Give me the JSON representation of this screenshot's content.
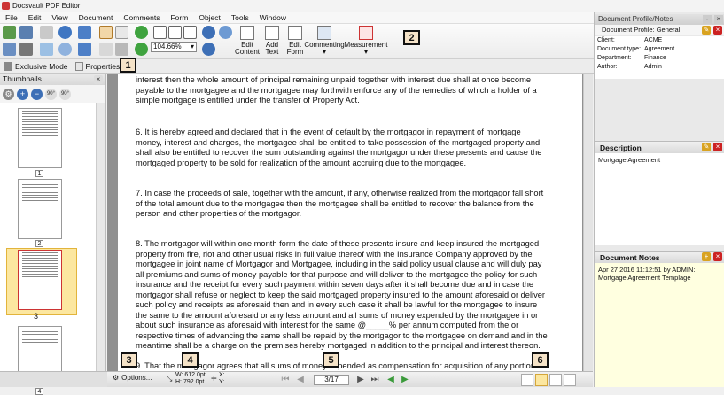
{
  "app": {
    "title": "Docsvault PDF Editor"
  },
  "menu": [
    "File",
    "Edit",
    "View",
    "Document",
    "Comments",
    "Form",
    "Object",
    "Tools",
    "Window"
  ],
  "toolbar": {
    "zoom_value": "104.66%",
    "edit_content": "Edit Content",
    "add_text": "Add Text",
    "edit_form": "Edit Form",
    "commenting": "Commenting",
    "measurement": "Measurement"
  },
  "secbar": {
    "exclusive_mode": "Exclusive Mode",
    "properties": "Properties..."
  },
  "thumbnails": {
    "title": "Thumbnails",
    "pages": [
      "1",
      "2",
      "3",
      "4"
    ],
    "selected_page": "3"
  },
  "document": {
    "paragraphs": [
      "interest then the whole amount of principal remaining unpaid together with interest due shall at once become payable to the mortgagee and the mortgagee may forthwith enforce any of the remedies of which a holder of a simple mortgage is entitled under the transfer of Property Act.",
      "6. It is hereby agreed and declared that in the event of default by the mortgagor in repayment of mortgage money, interest and charges, the mortgagee shall be entitled to take possession of the mortgaged property and shall also be entitled to recover the sum outstanding against the mortgagor under these presents and cause the mortgaged property to be sold for realization of the amount accruing due to the mortgagee.",
      "7. In case the proceeds of sale, together with the amount, if any, otherwise realized from the mortgagor fall short of the total amount due to the mortgagee then the mortgagee shall be entitled to recover the balance from the person and other properties of the mortgagor.",
      "8. The mortgagor will within one month form the date of these presents insure and keep insured the mortgaged property from fire, riot and other usual risks in full value thereof with the Insurance Company approved by the mortgagee in joint name of Mortgagor and Mortgagee, including in the said policy usual clause and will duly pay all premiums and sums of money payable for that purpose and will deliver to the mortgagee the policy for such insurance and the receipt for every such payment within seven days after it shall become due and in case the mortgagor shall refuse or neglect to keep the said mortgaged property insured to the amount aforesaid or deliver such policy and receipts as aforesaid then and in every such case it shall be lawful for the mortgagee to insure the same to the amount aforesaid or any less amount and all sums of money expended by the mortgagee in or about such insurance as aforesaid with interest for the same @_____% per annum computed from the or respective times of advancing the same shall be repaid by the mortgagor to the mortgagee on demand and in the meantime shall be a charge on the premises hereby mortgaged in addition to the principal and interest thereon.",
      "9. That the mortgagor agrees that all sums of money expended as compensation for acquisition of any portion"
    ]
  },
  "bottombar": {
    "options": "Options...",
    "width": "W: 612.0pt",
    "height": "H: 792.0pt",
    "x": "X:",
    "y": "Y:",
    "page_indicator": "3/17"
  },
  "badges": [
    "1",
    "2",
    "3",
    "4",
    "5",
    "6"
  ],
  "right_panel": {
    "profile_header": "Document Profile/Notes",
    "profile_sub": "Document Profile: General",
    "profile_rows": [
      {
        "key": "Client:",
        "value": "ACME"
      },
      {
        "key": "Document type:",
        "value": "Agreement"
      },
      {
        "key": "Department:",
        "value": "Finance"
      },
      {
        "key": "Author:",
        "value": "Admin"
      }
    ],
    "description_title": "Description",
    "description_text": "Mortgage Agreement",
    "notes_title": "Document Notes",
    "notes_text": "Apr 27 2016 11:12:51 by  ADMIN: Mortgage Agreement Templage"
  },
  "colors": {
    "badge_fill": "#f5e3c8",
    "note_bg": "#ffffe0",
    "selected_thumb": "#fce7a0"
  }
}
